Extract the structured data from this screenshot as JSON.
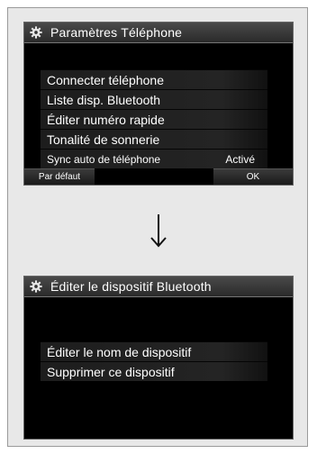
{
  "screen1": {
    "title": "Paramètres Téléphone",
    "icon": "gear-icon",
    "items": [
      {
        "label": "Connecter téléphone"
      },
      {
        "label": "Liste disp. Bluetooth"
      },
      {
        "label": "Éditer numéro rapide"
      },
      {
        "label": "Tonalité de sonnerie"
      },
      {
        "label": "Sync auto de téléphone",
        "value": "Activé"
      }
    ],
    "buttons": {
      "default": "Par défaut",
      "ok": "OK"
    }
  },
  "arrow": "down-arrow-icon",
  "screen2": {
    "title": "Éditer le dispositif Bluetooth",
    "icon": "gear-icon",
    "items": [
      {
        "label": "Éditer le nom de dispositif"
      },
      {
        "label": "Supprimer ce dispositif"
      }
    ]
  }
}
